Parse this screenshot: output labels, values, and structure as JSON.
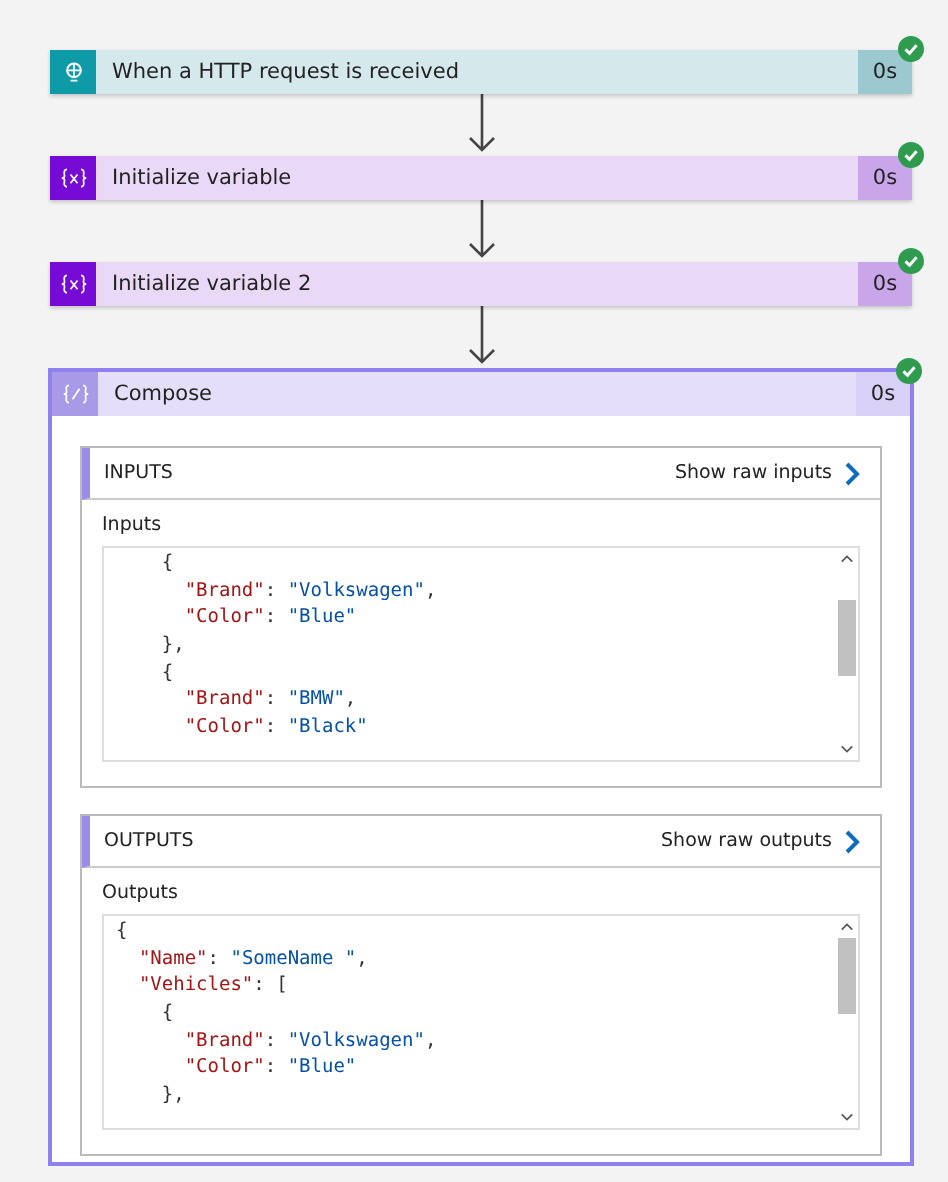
{
  "steps": [
    {
      "kind": "trigger",
      "title": "When a HTTP request is received",
      "duration": "0s",
      "succeeded": true
    },
    {
      "kind": "variable",
      "title": "Initialize variable",
      "duration": "0s",
      "succeeded": true
    },
    {
      "kind": "variable",
      "title": "Initialize variable 2",
      "duration": "0s",
      "succeeded": true
    }
  ],
  "compose": {
    "title": "Compose",
    "duration": "0s",
    "succeeded": true,
    "sections": [
      {
        "heading": "INPUTS",
        "link": "Show raw inputs",
        "label": "Inputs",
        "lines": [
          [
            {
              "kind": "punct",
              "text": "    {"
            }
          ],
          [
            {
              "kind": "key",
              "text": "      \"Brand\""
            },
            {
              "kind": "punct",
              "text": ": "
            },
            {
              "kind": "string",
              "text": "\"Volkswagen\""
            },
            {
              "kind": "punct",
              "text": ","
            }
          ],
          [
            {
              "kind": "key",
              "text": "      \"Color\""
            },
            {
              "kind": "punct",
              "text": ": "
            },
            {
              "kind": "string",
              "text": "\"Blue\""
            }
          ],
          [
            {
              "kind": "punct",
              "text": "    },"
            }
          ],
          [
            {
              "kind": "punct",
              "text": "    {"
            }
          ],
          [
            {
              "kind": "key",
              "text": "      \"Brand\""
            },
            {
              "kind": "punct",
              "text": ": "
            },
            {
              "kind": "string",
              "text": "\"BMW\""
            },
            {
              "kind": "punct",
              "text": ","
            }
          ],
          [
            {
              "kind": "key",
              "text": "      \"Color\""
            },
            {
              "kind": "punct",
              "text": ": "
            },
            {
              "kind": "string",
              "text": "\"Black\""
            }
          ]
        ]
      },
      {
        "heading": "OUTPUTS",
        "link": "Show raw outputs",
        "label": "Outputs",
        "lines": [
          [
            {
              "kind": "punct",
              "text": "{"
            }
          ],
          [
            {
              "kind": "key",
              "text": "  \"Name\""
            },
            {
              "kind": "punct",
              "text": ": "
            },
            {
              "kind": "string",
              "text": "\"SomeName \""
            },
            {
              "kind": "punct",
              "text": ","
            }
          ],
          [
            {
              "kind": "key",
              "text": "  \"Vehicles\""
            },
            {
              "kind": "punct",
              "text": ": ["
            }
          ],
          [
            {
              "kind": "punct",
              "text": "    {"
            }
          ],
          [
            {
              "kind": "key",
              "text": "      \"Brand\""
            },
            {
              "kind": "punct",
              "text": ": "
            },
            {
              "kind": "string",
              "text": "\"Volkswagen\""
            },
            {
              "kind": "punct",
              "text": ","
            }
          ],
          [
            {
              "kind": "key",
              "text": "      \"Color\""
            },
            {
              "kind": "punct",
              "text": ": "
            },
            {
              "kind": "string",
              "text": "\"Blue\""
            }
          ],
          [
            {
              "kind": "punct",
              "text": "    },"
            }
          ]
        ]
      }
    ]
  }
}
